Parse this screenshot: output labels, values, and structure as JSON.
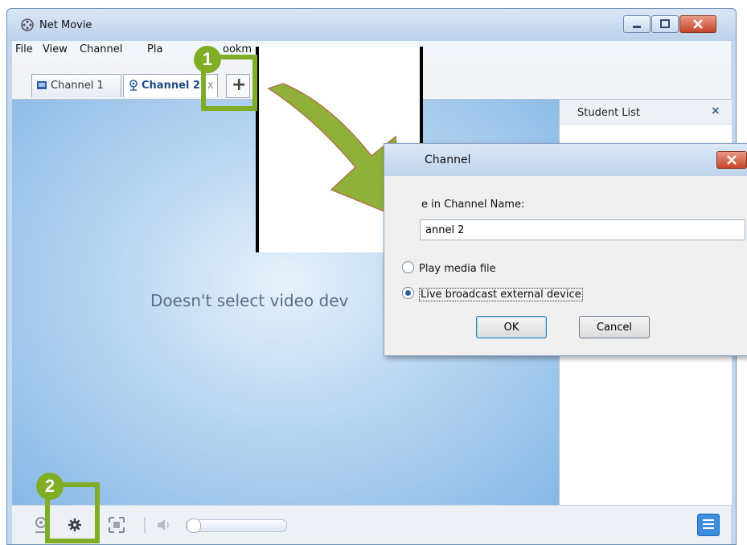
{
  "window": {
    "title": "Net Movie"
  },
  "menu": [
    "File",
    "View",
    "Channel",
    "Pla",
    "ookm"
  ],
  "tabs": [
    {
      "label": "Channel 1",
      "icon": "channel-screen-icon"
    },
    {
      "label": "Channel 2",
      "icon": "webcam-icon"
    }
  ],
  "tab_add_label": "+",
  "video": {
    "message": "Doesn't select video dev"
  },
  "panel": {
    "title": "Student List",
    "close": "×"
  },
  "dialog": {
    "title": "Channel",
    "label": "e in Channel Name:",
    "name_value": "annel 2",
    "options": [
      "Play media file",
      "Live broadcast external device"
    ],
    "selected_option": "Live broadcast external device",
    "ok_label": "OK",
    "cancel_label": "Cancel"
  },
  "callouts": [
    {
      "number": "1",
      "target": "add-channel-tab"
    },
    {
      "number": "2",
      "target": "settings-button"
    }
  ],
  "volume": {
    "level": 0
  },
  "colors": {
    "callout": "#7fae26",
    "arrow": "#8fb13a",
    "video_bg": "#b9d6f1"
  }
}
